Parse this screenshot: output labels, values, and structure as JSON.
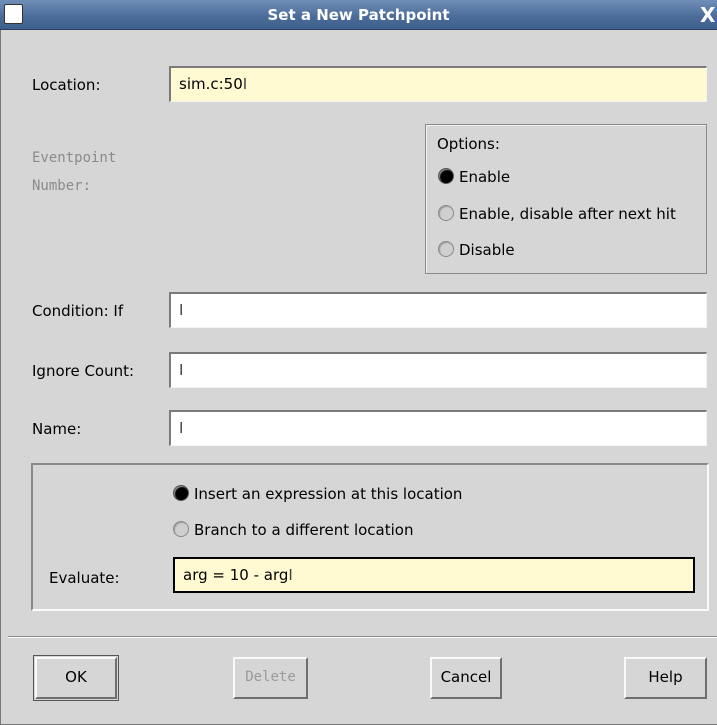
{
  "window": {
    "title": "Set a New Patchpoint",
    "close_glyph": "X"
  },
  "location": {
    "label": "Location:",
    "value": "sim.c:50"
  },
  "eventpoint": {
    "label_line1": "Eventpoint",
    "label_line2": "Number:"
  },
  "options": {
    "title": "Options:",
    "items": [
      {
        "label": "Enable",
        "selected": true
      },
      {
        "label": "Enable, disable after next hit",
        "selected": false
      },
      {
        "label": "Disable",
        "selected": false
      }
    ]
  },
  "condition": {
    "label": "Condition: If",
    "value": ""
  },
  "ignore_count": {
    "label": "Ignore Count:",
    "value": ""
  },
  "name": {
    "label": "Name:",
    "value": ""
  },
  "action": {
    "items": [
      {
        "label": "Insert an expression at this location",
        "selected": true
      },
      {
        "label": "Branch to a different location",
        "selected": false
      }
    ],
    "evaluate_label": "Evaluate:",
    "evaluate_value": "arg = 10 - arg"
  },
  "buttons": {
    "ok": "OK",
    "delete": "Delete",
    "cancel": "Cancel",
    "help": "Help"
  },
  "icons": [
    "window-menu-icon",
    "close-icon",
    "text-cursor-icon",
    "radio-icon"
  ]
}
